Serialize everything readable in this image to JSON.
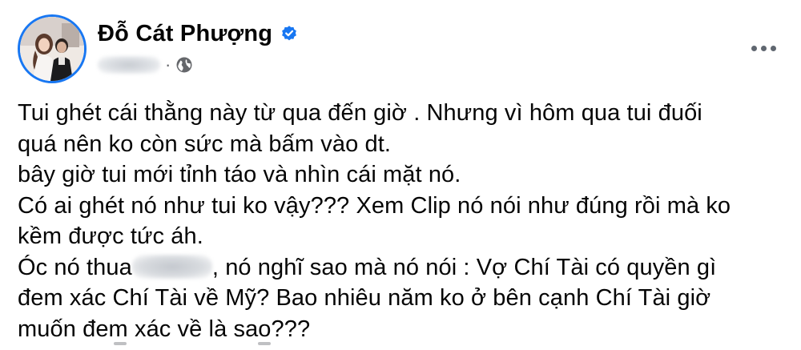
{
  "post": {
    "author": {
      "name": "Đỗ Cát Phượng",
      "verified_icon": "verified-badge-icon",
      "avatar_icon": "profile-photo"
    },
    "meta": {
      "separator": "·",
      "audience_icon": "globe-icon"
    },
    "more_icon": "more-options-icon",
    "lines": [
      "Tui ghét cái thằng này từ qua đến giờ .  Nhưng vì hôm qua tui đuối",
      "quá nên ko còn sức mà bấm vào dt.",
      "bây giờ tui mới tỉnh  táo và nhìn cái mặt nó.",
      "Có ai ghét nó như tui ko vậy??? Xem Clip nó nói như đúng rồi mà ko",
      "kềm được tức áh.",
      "",
      "đem xác Chí Tài về Mỹ? Bao nhiêu năm ko ở bên cạnh Chí Tài giờ",
      "muốn đem xác về là sao???"
    ],
    "line6": {
      "before": "Óc nó thua",
      "after": ", nó nghĩ sao mà nó nói : Vợ Chí Tài có quyền gì"
    }
  },
  "colors": {
    "verified": "#1877f2",
    "text": "#050505",
    "secondary": "#65676b",
    "avatar_ring": "#1877f2"
  }
}
